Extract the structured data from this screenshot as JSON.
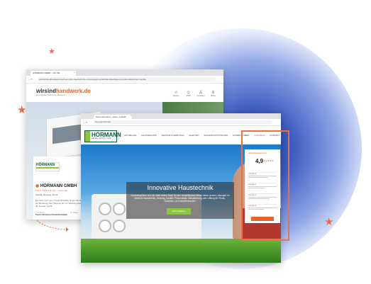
{
  "decorations": {
    "star_icon": "star-icon",
    "accent_color": "#e8704a",
    "glow_color": "#2f4bb0"
  },
  "browser_back": {
    "tab_title": "HÖRMANN GMBH – Ort: Bä...",
    "url": "www.wirsindhandwerk.de/hoermann-haustechnik-ort-campaign-wirsindhandwerk&source=referral&content=profile",
    "site_logo_prefix": "wirsind",
    "site_logo_suffix": "handwerk.de",
    "site_tagline": "Die regionale Plattform für Handwerk",
    "nav": [
      "Merken",
      "Profil",
      "Anmelden",
      "Suche"
    ],
    "company_name": "HÖRMANN GMBH",
    "company_rating": "100 % ★★★★★ (15) · Lesen Sie",
    "company_trades": "Sanitär, Heizung, Klima",
    "company_description": "Bei Team Hörmann Friedrichshafen finden Sie Heizungsanlagen. Von der Beratung über Planung bis zur Wartung erhalten Sie Haustechnik, die Freude macht.",
    "company_team": "Team Hörmann Friedrichshafen",
    "actions": [
      "Foto",
      "Video"
    ]
  },
  "browser_front": {
    "tab_title": "Team Hörmann – Haus...tecknik",
    "url": "hoermann-hv.de",
    "logo_word": "HÖRMANN",
    "logo_sub": "SANITÄR • HEIZUNG • KLIMA",
    "menu": [
      "AKTUELLES",
      "HAUSTECHNIK",
      "SERVICE & WARTUNG",
      "ELEKTRO",
      "SOLAR/PHOTOVOLTAIK",
      "UNTERNEHMEN",
      "KARRIERE",
      "KONTAKT"
    ],
    "hero_title": "Innovative Haustechnik",
    "hero_text": "Kernkompetenz und mit unter einem Dach für den Umweltschutz bieten diese unsere Lösungen im Bereich Haustechnik, Heizung, Sanitär, Photovoltaik, Klimatisierung und Lüftung für Privat-, Gewerbe- und Industriekunden.",
    "hero_button": "Mehr Erfahren",
    "rating_panel": {
      "title": "wirsindhandwerk.de",
      "score": "4,9",
      "stars": "★★★★★",
      "review_stars": "★★★★★"
    }
  }
}
